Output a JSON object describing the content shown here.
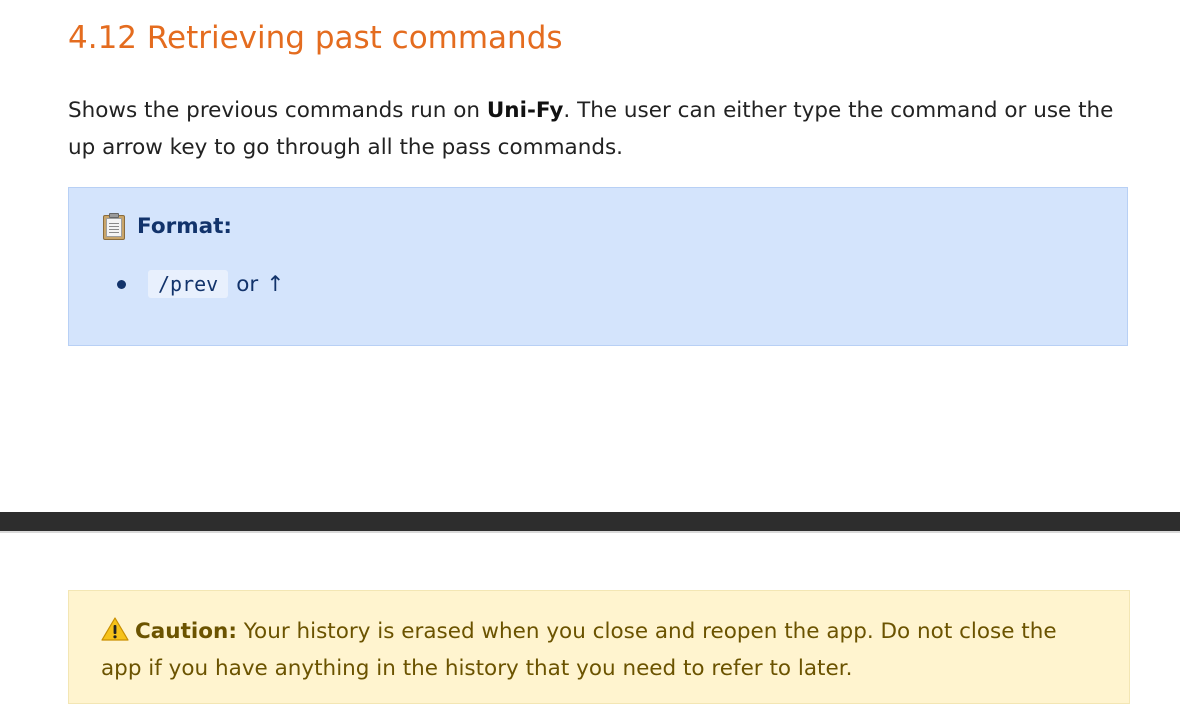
{
  "section": {
    "title": "4.12 Retrieving past commands"
  },
  "intro": {
    "prefix": "Shows the previous commands run on ",
    "app_name": "Uni-Fy",
    "suffix": ". The user can either type the command or use the up arrow key to go through all the pass commands."
  },
  "format_box": {
    "icon": "clipboard-icon",
    "label": "Format:",
    "items": [
      {
        "code": "/prev",
        "connector": "or",
        "arrow": "↑"
      }
    ]
  },
  "caution_box": {
    "icon": "warning-icon",
    "label": "Caution:",
    "text": " Your history is erased when you close and reopen the app. Do not close the app if you have anything in the history that you need to refer to later."
  },
  "colors": {
    "title": "#e46c1f",
    "body_text": "#222222",
    "format_bg": "#d4e4fc",
    "format_text": "#12336b",
    "caution_bg": "#fff4cf",
    "caution_text": "#6b5300",
    "divider_bar": "#2d2d2d"
  }
}
